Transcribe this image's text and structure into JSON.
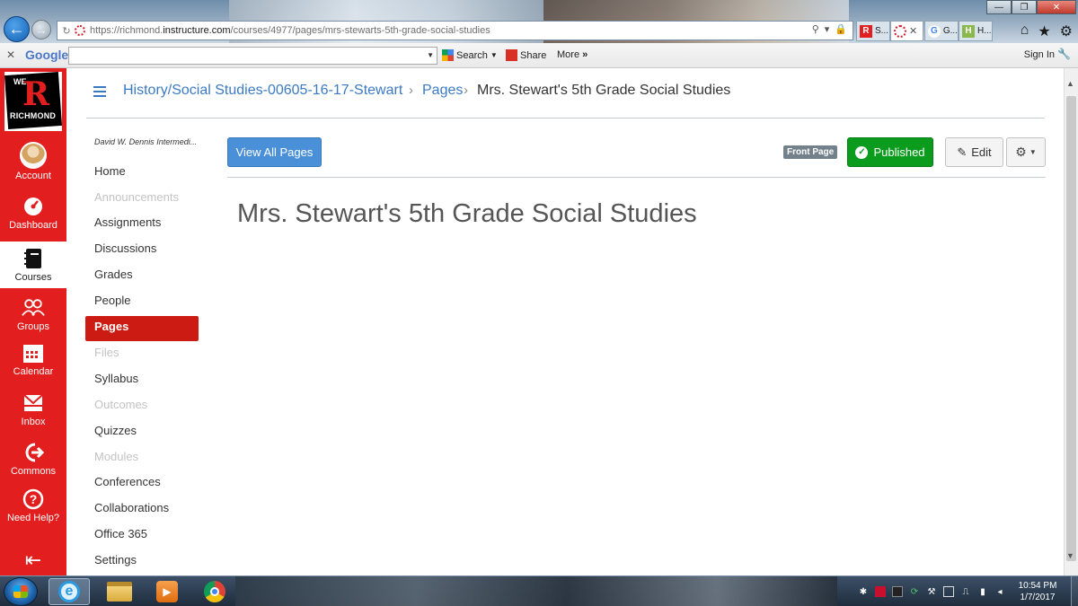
{
  "browser": {
    "url_prefix": "https://richmond.",
    "url_host": "instructure.com",
    "url_path": "/courses/4977/pages/mrs-stewarts-5th-grade-social-studies",
    "tabs": [
      {
        "label": "S..."
      },
      {
        "label": ""
      },
      {
        "label": "G..."
      },
      {
        "label": "H..."
      }
    ]
  },
  "google_toolbar": {
    "logo": "Google",
    "search_label": "Search",
    "share_label": "Share",
    "more_label": "More",
    "sign_in_label": "Sign In"
  },
  "global_nav": {
    "logo_top": "WE",
    "logo_letter": "R",
    "logo_bottom": "RICHMOND",
    "items": [
      {
        "label": "Account"
      },
      {
        "label": "Dashboard"
      },
      {
        "label": "Courses"
      },
      {
        "label": "Groups"
      },
      {
        "label": "Calendar"
      },
      {
        "label": "Inbox"
      },
      {
        "label": "Commons"
      },
      {
        "label": "Need Help?"
      }
    ]
  },
  "breadcrumb": {
    "course": "History/Social Studies-00605-16-17-Stewart",
    "section": "Pages",
    "current": "Mrs. Stewart's 5th Grade Social Studies"
  },
  "course_nav": {
    "term": "David W. Dennis Intermedi...",
    "items": [
      {
        "label": "Home"
      },
      {
        "label": "Announcements"
      },
      {
        "label": "Assignments"
      },
      {
        "label": "Discussions"
      },
      {
        "label": "Grades"
      },
      {
        "label": "People"
      },
      {
        "label": "Pages"
      },
      {
        "label": "Files"
      },
      {
        "label": "Syllabus"
      },
      {
        "label": "Outcomes"
      },
      {
        "label": "Quizzes"
      },
      {
        "label": "Modules"
      },
      {
        "label": "Conferences"
      },
      {
        "label": "Collaborations"
      },
      {
        "label": "Office 365"
      },
      {
        "label": "Settings"
      }
    ]
  },
  "page": {
    "view_all_label": "View All Pages",
    "front_page_badge": "Front Page",
    "published_label": "Published",
    "edit_label": "Edit",
    "title": "Mrs. Stewart's 5th Grade Social Studies"
  },
  "taskbar": {
    "time": "10:54 PM",
    "date": "1/7/2017"
  },
  "colors": {
    "canvas_red": "#e21e1e",
    "link_blue": "#3b7ac3",
    "published_green": "#0b9c1e",
    "active_nav_red": "#cc1b12"
  }
}
